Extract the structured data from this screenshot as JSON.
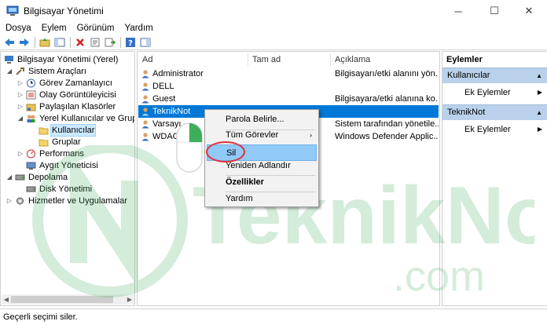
{
  "window": {
    "title": "Bilgisayar Yönetimi",
    "minimize_glyph": "─",
    "maximize_glyph": "☐",
    "close_glyph": "✕"
  },
  "menu": [
    "Dosya",
    "Eylem",
    "Görünüm",
    "Yardım"
  ],
  "toolbar": {
    "icons": [
      "back-arrow-icon",
      "forward-arrow-icon",
      "up-folder-icon",
      "show-hide-tree-icon",
      "delete-icon",
      "properties-icon",
      "export-list-icon",
      "help-icon",
      "action-pane-icon"
    ]
  },
  "tree": {
    "items": [
      {
        "label": "Bilgisayar Yönetimi (Yerel)",
        "expander": ""
      },
      {
        "label": "Sistem Araçları",
        "expander": "◢"
      },
      {
        "label": "Görev Zamanlayıcı",
        "expander": "▷"
      },
      {
        "label": "Olay Görüntüleyicisi",
        "expander": "▷"
      },
      {
        "label": "Paylaşılan Klasörler",
        "expander": "▷"
      },
      {
        "label": "Yerel Kullanıcılar ve Grupla",
        "expander": "◢"
      },
      {
        "label": "Kullanıcılar",
        "expander": ""
      },
      {
        "label": "Gruplar",
        "expander": ""
      },
      {
        "label": "Performans",
        "expander": "▷"
      },
      {
        "label": "Aygıt Yöneticisi",
        "expander": ""
      },
      {
        "label": "Depolama",
        "expander": "◢"
      },
      {
        "label": "Disk Yönetimi",
        "expander": ""
      },
      {
        "label": "Hizmetler ve Uygulamalar",
        "expander": "▷"
      }
    ]
  },
  "list": {
    "columns": [
      "Ad",
      "Tam ad",
      "Açıklama"
    ],
    "rows": [
      {
        "name": "Administrator",
        "full_name": "",
        "description": "Bilgisayarı/etki alanını yön..."
      },
      {
        "name": "DELL",
        "full_name": "",
        "description": ""
      },
      {
        "name": "Guest",
        "full_name": "",
        "description": "Bilgisayara/etki alanına ko..."
      },
      {
        "name": "TeknikNot",
        "full_name": "",
        "description": ""
      },
      {
        "name": "Varsayı",
        "full_name": "",
        "description": "Sistem tarafından yönetile..."
      },
      {
        "name": "WDAG",
        "full_name": "",
        "description": "Windows Defender Applic..."
      }
    ]
  },
  "context_menu": {
    "items": [
      "Parola Belirle...",
      "Tüm Görevler",
      "Sil",
      "Yeniden Adlandır",
      "Özellikler",
      "Yardım"
    ],
    "submenu_glyph": "›"
  },
  "actions": {
    "title": "Eylemler",
    "groups": [
      {
        "label": "Kullanıcılar",
        "item": "Ek Eylemler"
      },
      {
        "label": "TeknikNot",
        "item": "Ek Eylemler"
      }
    ],
    "collapse_glyph": "▲",
    "more_glyph": "▶"
  },
  "status": {
    "text": "Geçerli seçimi siler."
  },
  "watermark": {
    "line1": "TeknikNot",
    "line2": ".com"
  },
  "colors": {
    "selection": "#0078d7",
    "menu_hot": "#91c9f7",
    "ring": "#e0303a",
    "watermark": "#3fae5b"
  }
}
